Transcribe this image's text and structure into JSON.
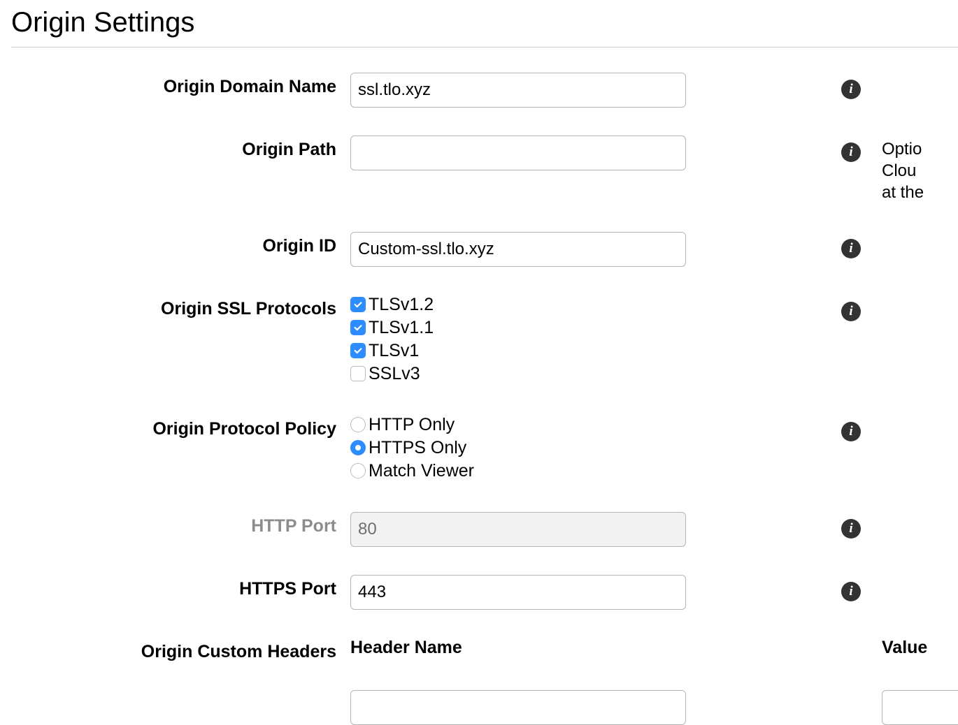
{
  "page": {
    "title": "Origin Settings"
  },
  "fields": {
    "domain": {
      "label": "Origin Domain Name",
      "value": "ssl.tlo.xyz"
    },
    "path": {
      "label": "Origin Path",
      "value": "",
      "help": "Optio\nClou\nat th"
    },
    "id": {
      "label": "Origin ID",
      "value": "Custom-ssl.tlo.xyz"
    },
    "ssl": {
      "label": "Origin SSL Protocols",
      "options": [
        {
          "label": "TLSv1.2",
          "checked": true
        },
        {
          "label": "TLSv1.1",
          "checked": true
        },
        {
          "label": "TLSv1",
          "checked": true
        },
        {
          "label": "SSLv3",
          "checked": false
        }
      ]
    },
    "policy": {
      "label": "Origin Protocol Policy",
      "options": [
        {
          "label": "HTTP Only",
          "selected": false
        },
        {
          "label": "HTTPS Only",
          "selected": true
        },
        {
          "label": "Match Viewer",
          "selected": false
        }
      ]
    },
    "http": {
      "label": "HTTP Port",
      "value": "80",
      "disabled": true
    },
    "https": {
      "label": "HTTPS Port",
      "value": "443"
    },
    "custom": {
      "label": "Origin Custom Headers",
      "headerName": "Header Name",
      "value": "Value",
      "inputValue": ""
    }
  }
}
